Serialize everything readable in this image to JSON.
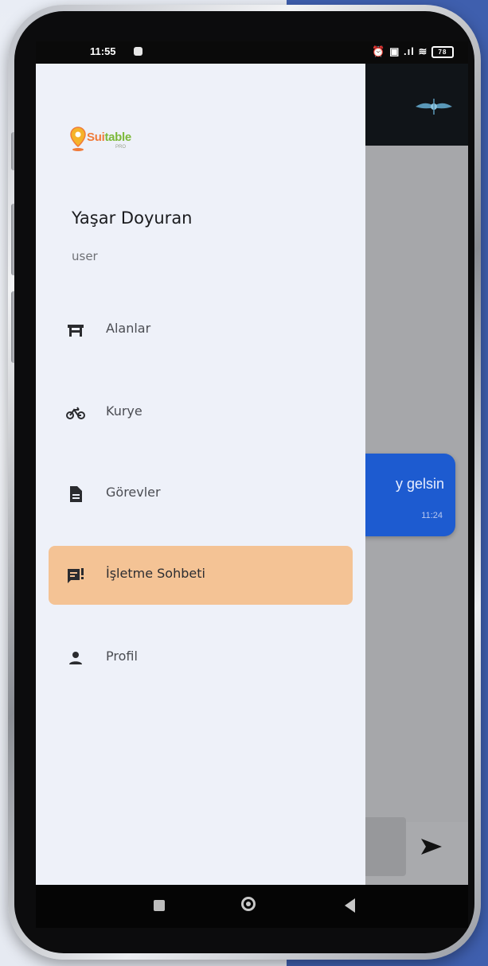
{
  "status_bar": {
    "time": "11:55",
    "icons": "⏰ ▣ .ıl ≋",
    "battery": "78"
  },
  "background_app": {
    "message_text": "y gelsin",
    "message_time": "11:24"
  },
  "drawer": {
    "brand": {
      "name_main": "Sui",
      "name_highlight": "table",
      "sub": "PRO"
    },
    "user": {
      "name": "Yaşar Doyuran",
      "role": "user"
    },
    "menu": [
      {
        "label": "Alanlar",
        "icon": "table-icon",
        "active": false
      },
      {
        "label": "Kurye",
        "icon": "bicycle-icon",
        "active": false
      },
      {
        "label": "Görevler",
        "icon": "document-icon",
        "active": false
      },
      {
        "label": "İşletme Sohbeti",
        "icon": "chat-list-icon",
        "active": true
      },
      {
        "label": "Profil",
        "icon": "person-icon",
        "active": false
      }
    ]
  },
  "colors": {
    "drawer_bg": "#eef1f9",
    "active_item": "#f4c395",
    "bubble": "#1d5bd0",
    "brand_orange": "#f07b3a",
    "brand_green": "#7cb93a"
  }
}
